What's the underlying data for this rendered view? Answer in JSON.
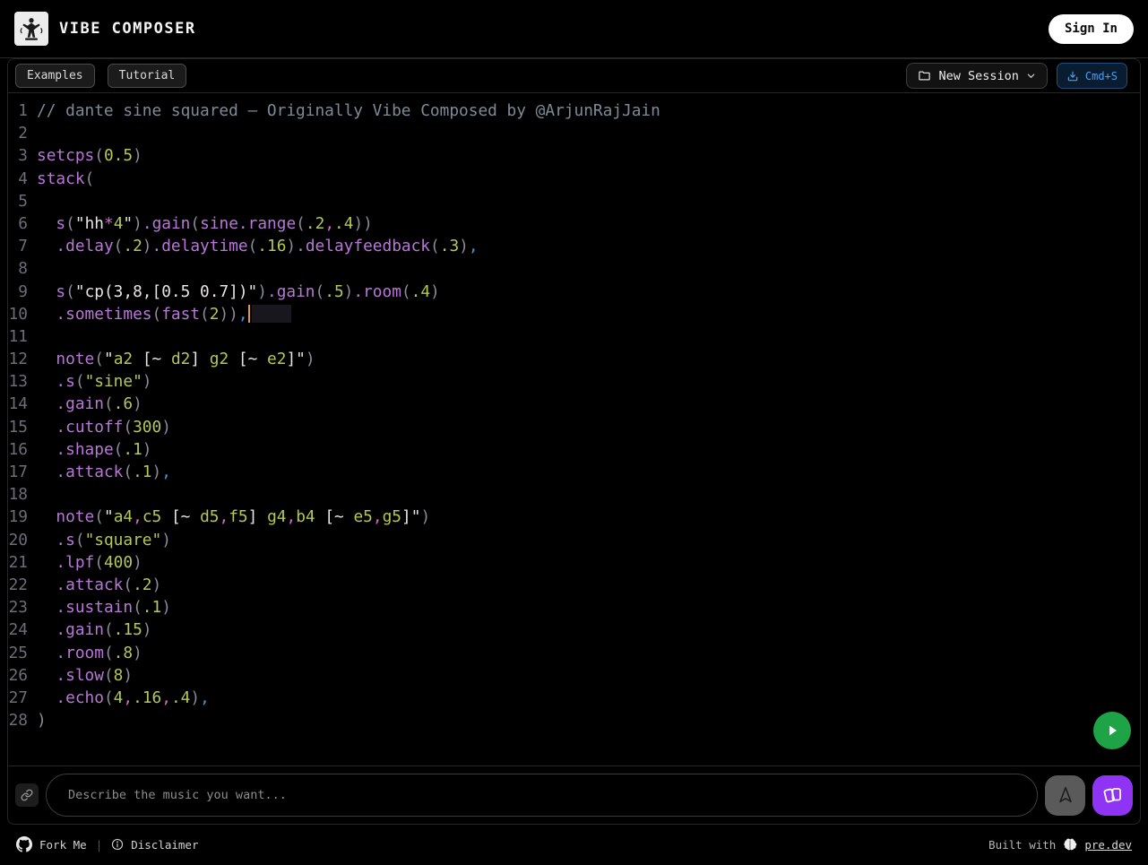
{
  "header": {
    "title": "VIBE COMPOSER",
    "sign_in_label": "Sign In"
  },
  "toolbar": {
    "examples_label": "Examples",
    "tutorial_label": "Tutorial",
    "new_session_label": "New Session",
    "cmd_s_label": "Cmd+S"
  },
  "editor": {
    "caret_line": 10,
    "token_colors": {
      "f": "#b878d8",
      "n": "#b5c754",
      "s": "#e8e6e2",
      "p": "#8e8a99",
      "m": "#cf6ace",
      "b": "#3f9ad6",
      "c": "#7d8b99",
      "t": "#d8d8d8"
    },
    "lines": [
      [
        [
          "c",
          "// dante sine squared — Originally Vibe Composed by @ArjunRajJain"
        ]
      ],
      [],
      [
        [
          "f",
          "setcps"
        ],
        [
          "p",
          "("
        ],
        [
          "n",
          "0.5"
        ],
        [
          "p",
          ")"
        ]
      ],
      [
        [
          "f",
          "stack"
        ],
        [
          "p",
          "("
        ]
      ],
      [],
      [
        [
          "t",
          "  "
        ],
        [
          "f",
          "s"
        ],
        [
          "p",
          "("
        ],
        [
          "s",
          "\"hh"
        ],
        [
          "m",
          "*"
        ],
        [
          "n",
          "4"
        ],
        [
          "s",
          "\""
        ],
        [
          "p",
          ")"
        ],
        [
          "f",
          ".gain"
        ],
        [
          "p",
          "("
        ],
        [
          "f",
          "sine.range"
        ],
        [
          "p",
          "("
        ],
        [
          "n",
          ".2"
        ],
        [
          "m",
          ","
        ],
        [
          "n",
          ".4"
        ],
        [
          "p",
          "))"
        ]
      ],
      [
        [
          "t",
          "  "
        ],
        [
          "f",
          ".delay"
        ],
        [
          "p",
          "("
        ],
        [
          "n",
          ".2"
        ],
        [
          "p",
          ")"
        ],
        [
          "f",
          ".delaytime"
        ],
        [
          "p",
          "("
        ],
        [
          "n",
          ".16"
        ],
        [
          "p",
          ")"
        ],
        [
          "f",
          ".delayfeedback"
        ],
        [
          "p",
          "("
        ],
        [
          "n",
          ".3"
        ],
        [
          "p",
          ")"
        ],
        [
          "b",
          ","
        ]
      ],
      [],
      [
        [
          "t",
          "  "
        ],
        [
          "f",
          "s"
        ],
        [
          "p",
          "("
        ],
        [
          "s",
          "\"cp(3,8,[0.5 0.7])\""
        ],
        [
          "p",
          ")"
        ],
        [
          "f",
          ".gain"
        ],
        [
          "p",
          "("
        ],
        [
          "n",
          ".5"
        ],
        [
          "p",
          ")"
        ],
        [
          "f",
          ".room"
        ],
        [
          "p",
          "("
        ],
        [
          "n",
          ".4"
        ],
        [
          "p",
          ")"
        ]
      ],
      [
        [
          "t",
          "  "
        ],
        [
          "f",
          ".sometimes"
        ],
        [
          "p",
          "("
        ],
        [
          "f",
          "fast"
        ],
        [
          "p",
          "("
        ],
        [
          "n",
          "2"
        ],
        [
          "p",
          "))"
        ],
        [
          "b",
          ","
        ],
        [
          "caret",
          ""
        ]
      ],
      [],
      [
        [
          "t",
          "  "
        ],
        [
          "f",
          "note"
        ],
        [
          "p",
          "("
        ],
        [
          "s",
          "\""
        ],
        [
          "n",
          "a2"
        ],
        [
          "s",
          " [~ "
        ],
        [
          "n",
          "d2"
        ],
        [
          "s",
          "] "
        ],
        [
          "n",
          "g2"
        ],
        [
          "s",
          " [~ "
        ],
        [
          "n",
          "e2"
        ],
        [
          "s",
          "]\""
        ],
        [
          "p",
          ")"
        ]
      ],
      [
        [
          "t",
          "  "
        ],
        [
          "f",
          ".s"
        ],
        [
          "p",
          "("
        ],
        [
          "n",
          "\"sine\""
        ],
        [
          "p",
          ")"
        ]
      ],
      [
        [
          "t",
          "  "
        ],
        [
          "f",
          ".gain"
        ],
        [
          "p",
          "("
        ],
        [
          "n",
          ".6"
        ],
        [
          "p",
          ")"
        ]
      ],
      [
        [
          "t",
          "  "
        ],
        [
          "f",
          ".cutoff"
        ],
        [
          "p",
          "("
        ],
        [
          "n",
          "300"
        ],
        [
          "p",
          ")"
        ]
      ],
      [
        [
          "t",
          "  "
        ],
        [
          "f",
          ".shape"
        ],
        [
          "p",
          "("
        ],
        [
          "n",
          ".1"
        ],
        [
          "p",
          ")"
        ]
      ],
      [
        [
          "t",
          "  "
        ],
        [
          "f",
          ".attack"
        ],
        [
          "p",
          "("
        ],
        [
          "n",
          ".1"
        ],
        [
          "p",
          ")"
        ],
        [
          "b",
          ","
        ]
      ],
      [],
      [
        [
          "t",
          "  "
        ],
        [
          "f",
          "note"
        ],
        [
          "p",
          "("
        ],
        [
          "s",
          "\""
        ],
        [
          "n",
          "a4"
        ],
        [
          "m",
          ","
        ],
        [
          "n",
          "c5"
        ],
        [
          "s",
          " [~ "
        ],
        [
          "n",
          "d5"
        ],
        [
          "m",
          ","
        ],
        [
          "n",
          "f5"
        ],
        [
          "s",
          "] "
        ],
        [
          "n",
          "g4"
        ],
        [
          "m",
          ","
        ],
        [
          "n",
          "b4"
        ],
        [
          "s",
          " [~ "
        ],
        [
          "n",
          "e5"
        ],
        [
          "m",
          ","
        ],
        [
          "n",
          "g5"
        ],
        [
          "s",
          "]\""
        ],
        [
          "p",
          ")"
        ]
      ],
      [
        [
          "t",
          "  "
        ],
        [
          "f",
          ".s"
        ],
        [
          "p",
          "("
        ],
        [
          "n",
          "\"square\""
        ],
        [
          "p",
          ")"
        ]
      ],
      [
        [
          "t",
          "  "
        ],
        [
          "f",
          ".lpf"
        ],
        [
          "p",
          "("
        ],
        [
          "n",
          "400"
        ],
        [
          "p",
          ")"
        ]
      ],
      [
        [
          "t",
          "  "
        ],
        [
          "f",
          ".attack"
        ],
        [
          "p",
          "("
        ],
        [
          "n",
          ".2"
        ],
        [
          "p",
          ")"
        ]
      ],
      [
        [
          "t",
          "  "
        ],
        [
          "f",
          ".sustain"
        ],
        [
          "p",
          "("
        ],
        [
          "n",
          ".1"
        ],
        [
          "p",
          ")"
        ]
      ],
      [
        [
          "t",
          "  "
        ],
        [
          "f",
          ".gain"
        ],
        [
          "p",
          "("
        ],
        [
          "n",
          ".15"
        ],
        [
          "p",
          ")"
        ]
      ],
      [
        [
          "t",
          "  "
        ],
        [
          "f",
          ".room"
        ],
        [
          "p",
          "("
        ],
        [
          "n",
          ".8"
        ],
        [
          "p",
          ")"
        ]
      ],
      [
        [
          "t",
          "  "
        ],
        [
          "f",
          ".slow"
        ],
        [
          "p",
          "("
        ],
        [
          "n",
          "8"
        ],
        [
          "p",
          ")"
        ]
      ],
      [
        [
          "t",
          "  "
        ],
        [
          "f",
          ".echo"
        ],
        [
          "p",
          "("
        ],
        [
          "n",
          "4"
        ],
        [
          "m",
          ","
        ],
        [
          "n",
          ".16"
        ],
        [
          "m",
          ","
        ],
        [
          "n",
          ".4"
        ],
        [
          "p",
          ")"
        ],
        [
          "b",
          ","
        ]
      ],
      [
        [
          "p",
          ")"
        ]
      ]
    ]
  },
  "prompt": {
    "placeholder": "Describe the music you want..."
  },
  "footer": {
    "fork_me_label": "Fork Me",
    "separator": "|",
    "disclaimer_label": "Disclaimer",
    "built_with_label": "Built with",
    "brand_label": "pre.dev"
  },
  "colors": {
    "accent_green": "#1ea446",
    "accent_purple": "#8f34f4",
    "accent_blue": "#4a9fe8",
    "caret_orange": "#e0993d"
  }
}
